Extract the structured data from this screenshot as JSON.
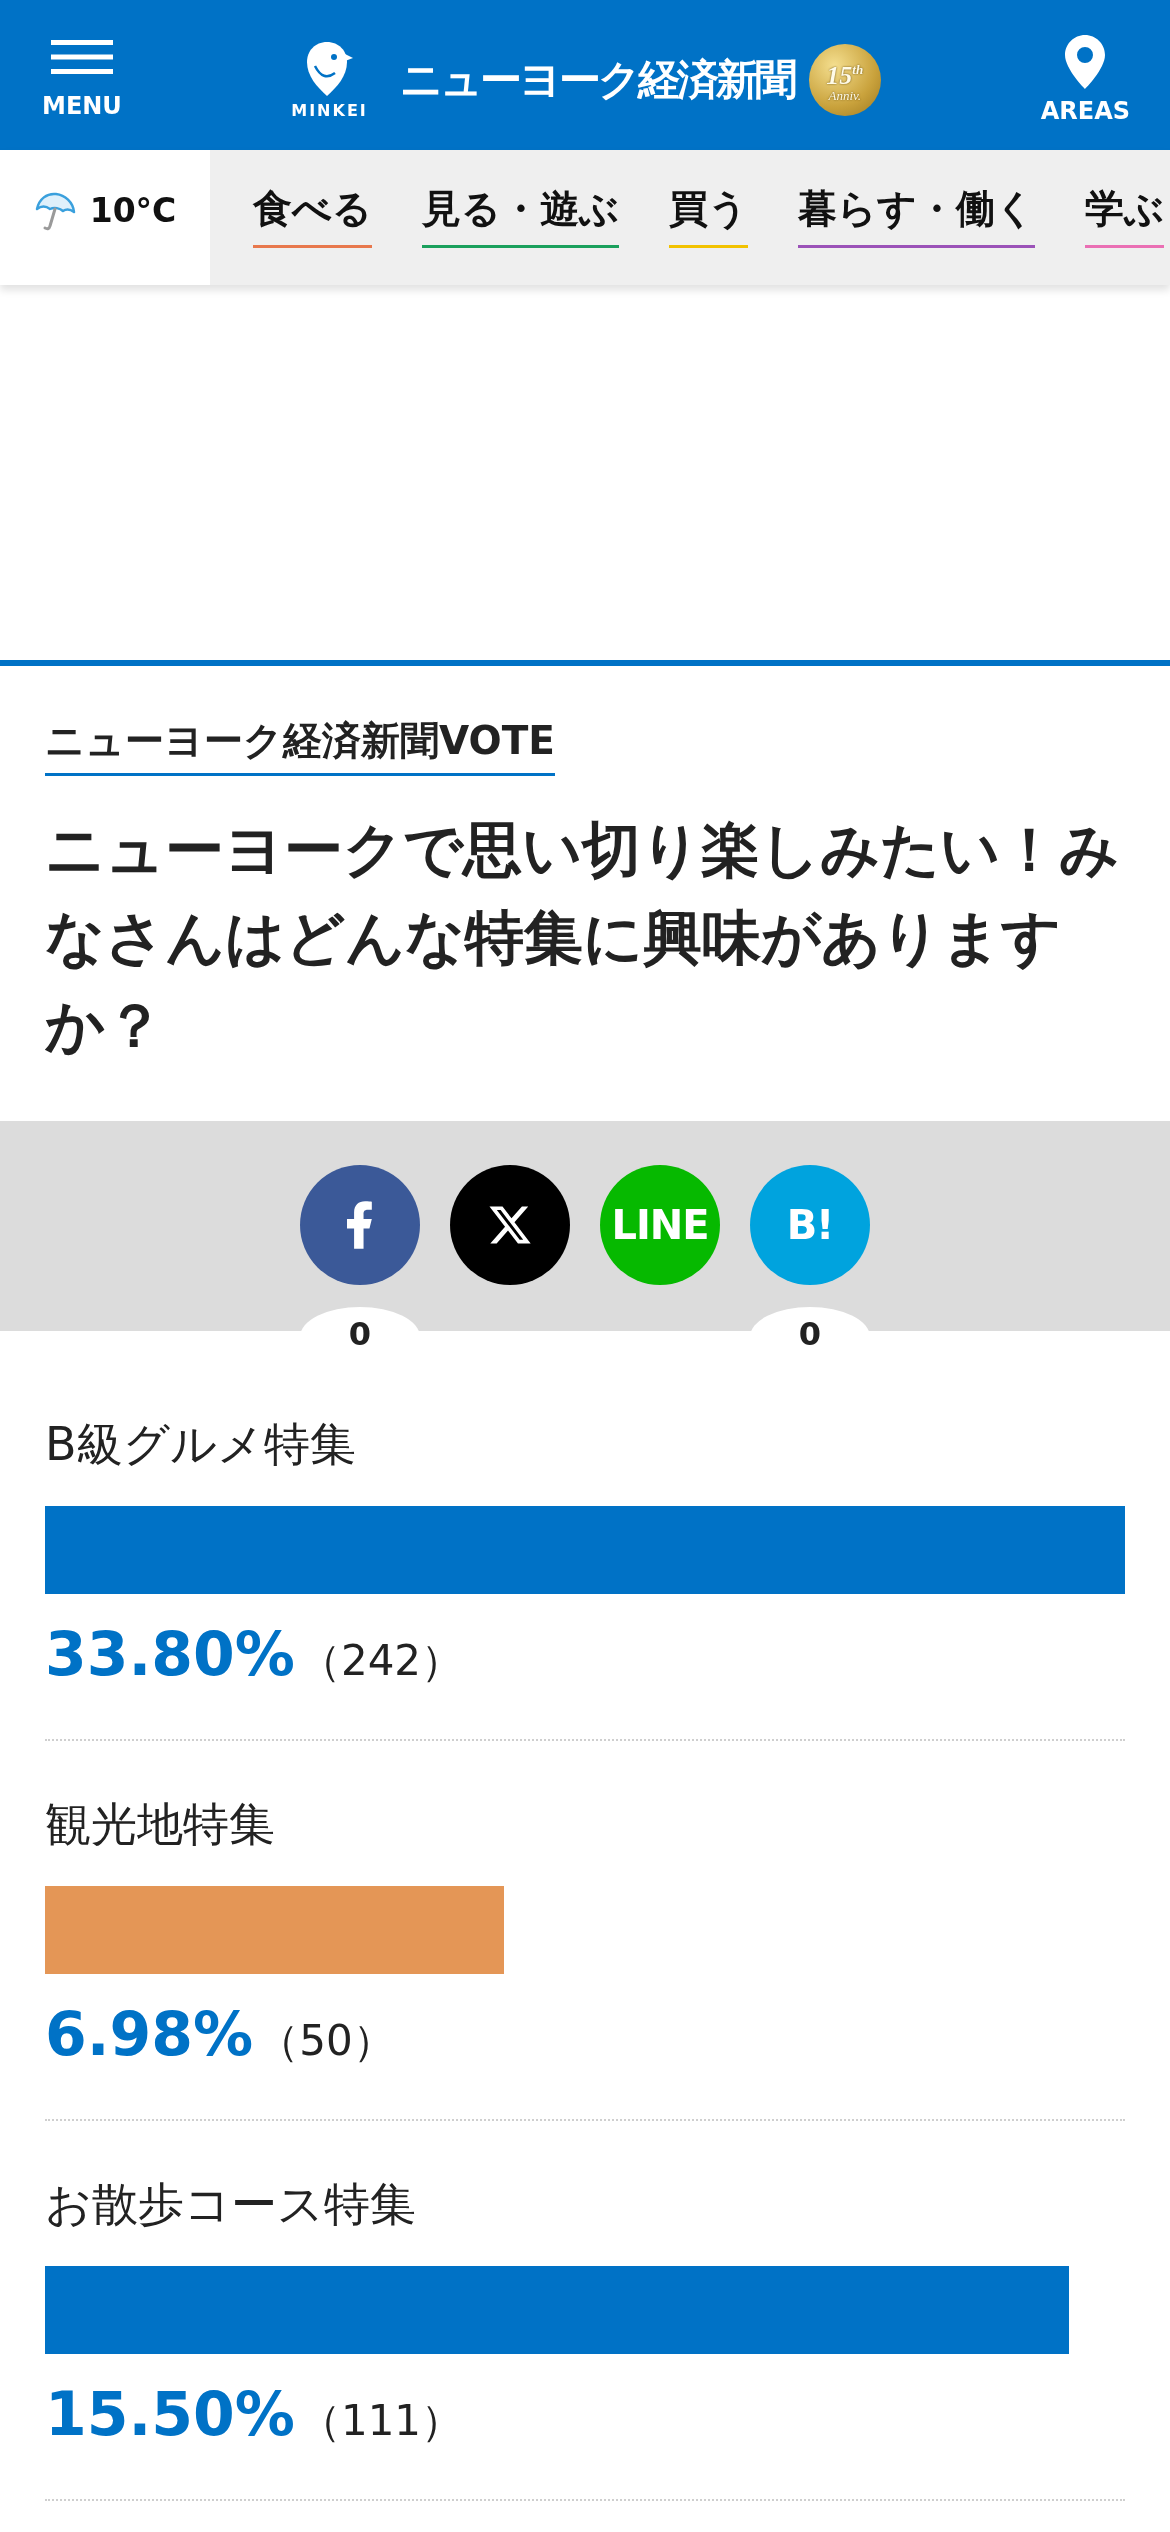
{
  "header": {
    "menu_label": "MENU",
    "logo": {
      "brand": "MINKEI",
      "title": "ニューヨーク経済新聞",
      "badge_number": "15$^{th}$",
      "badge_text": "Anniv."
    },
    "areas_label": "AREAS"
  },
  "weather": {
    "temperature": "10°C"
  },
  "nav": [
    {
      "label": "食べる",
      "color": "#e8784d"
    },
    {
      "label": "見る・遊ぶ",
      "color": "#1aa05c"
    },
    {
      "label": "買う",
      "color": "#f2c200"
    },
    {
      "label": "暮らす・働く",
      "color": "#9b52b8"
    },
    {
      "label": "学ぶ",
      "color": "#ea6fb4"
    }
  ],
  "vote": {
    "section_label": "ニューヨーク経済新聞VOTE",
    "question": "ニューヨークで思い切り楽しみたい！みなさんはどんな特集に興味がありますか？"
  },
  "share": [
    {
      "kind": "facebook",
      "count": "0"
    },
    {
      "kind": "x"
    },
    {
      "kind": "line",
      "label": "LINE"
    },
    {
      "kind": "hatena",
      "label": "B!",
      "count": "0"
    }
  ],
  "options": [
    {
      "label": "B級グルメ特集",
      "level": 1,
      "color": "#0072c6",
      "percent": "33.80%",
      "votes": "（242）"
    },
    {
      "label": "観光地特集",
      "level": 0.425,
      "color": "#e49656",
      "percent": "6.98%",
      "votes": "（50）"
    },
    {
      "label": "お散歩コース特集",
      "level": 0.948,
      "color": "#0072c6",
      "percent": "15.50%",
      "votes": "（111）"
    }
  ]
}
